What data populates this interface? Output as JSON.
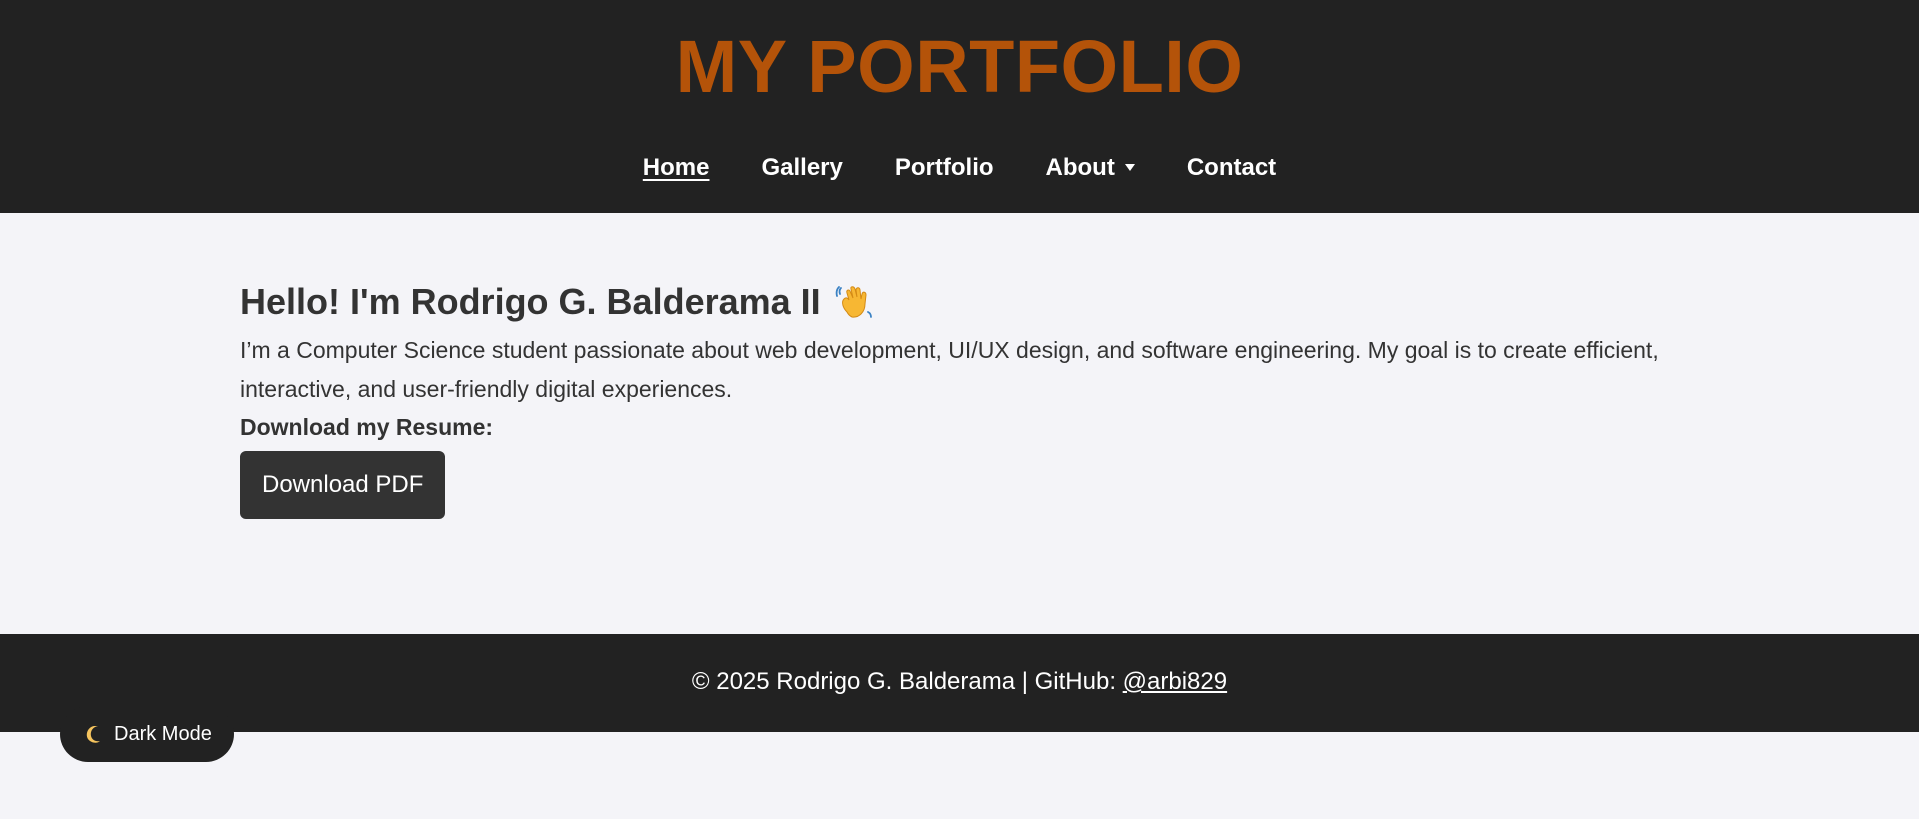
{
  "header": {
    "title": "MY PORTFOLIO"
  },
  "nav": {
    "items": [
      {
        "label": "Home",
        "active": true
      },
      {
        "label": "Gallery"
      },
      {
        "label": "Portfolio"
      },
      {
        "label": "About",
        "has_dropdown": true
      },
      {
        "label": "Contact"
      }
    ]
  },
  "intro": {
    "greeting": "Hello! I'm Rodrigo G. Balderama II",
    "greeting_icon": "waving-hand-icon",
    "bio": "I’m a Computer Science student passionate about web development, UI/UX design, and software engineering. My goal is to create efficient, interactive, and user-friendly digital experiences.",
    "resume_label": "Download my Resume:",
    "download_button": "Download PDF"
  },
  "footer": {
    "text": "© 2025 Rodrigo G. Balderama | GitHub: ",
    "github_link": "@arbi829"
  },
  "dark_mode_toggle": {
    "label": "Dark Mode",
    "icon": "moon-icon"
  },
  "colors": {
    "header_bg": "#222222",
    "title_accent": "#b45309",
    "page_bg": "#f4f4f8",
    "button_bg": "#333333",
    "text": "#333333"
  }
}
